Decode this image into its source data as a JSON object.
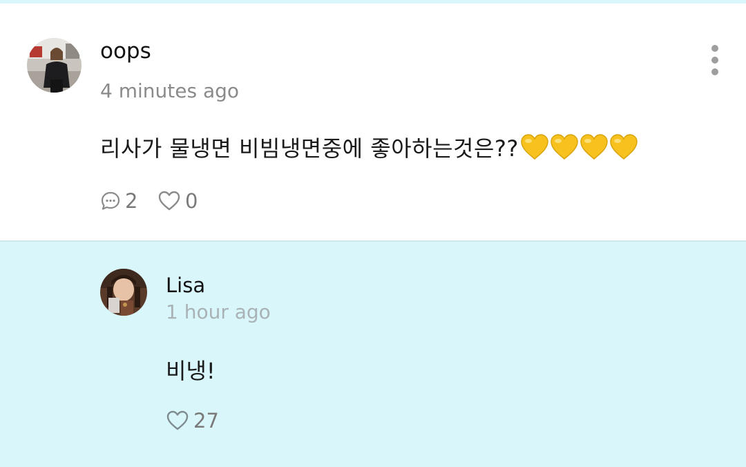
{
  "comment": {
    "username": "oops",
    "timestamp": "4 minutes ago",
    "text": "리사가 물냉면 비빔냉면중에 좋아하는것은??",
    "emoji": [
      "yellow-heart",
      "yellow-heart",
      "yellow-heart",
      "yellow-heart"
    ],
    "reply_count": "2",
    "like_count": "0"
  },
  "reply": {
    "username": "Lisa",
    "timestamp": "1 hour ago",
    "text": "비냉!",
    "like_count": "27"
  },
  "colors": {
    "card_background": "#ffffff",
    "reply_background": "#d9f6fb",
    "emoji_heart": "#f7c21e",
    "muted_text": "#8a8a8a",
    "reply_muted_text": "#a9b2b4"
  }
}
